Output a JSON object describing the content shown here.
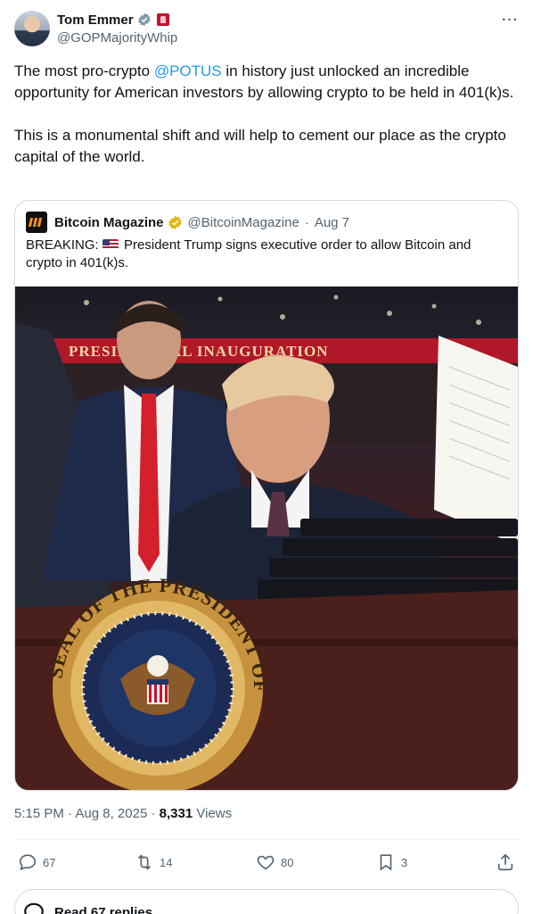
{
  "author": {
    "display_name": "Tom Emmer",
    "handle": "@GOPMajorityWhip"
  },
  "menu_icon": "more-horizontal-icon",
  "tweet": {
    "part1_before": "The most pro-crypto ",
    "mention": "@POTUS",
    "part1_after": " in history just unlocked an incredible opportunity for American investors by allowing crypto to be held in 401(k)s.",
    "part2": "This is a monumental shift and will help to cement our place as the crypto capital of the world."
  },
  "quote": {
    "display_name": "Bitcoin Magazine",
    "handle": "@BitcoinMagazine",
    "separator": "·",
    "date": "Aug 7",
    "text_prefix": "BREAKING: ",
    "text_body": "President Trump signs executive order to allow Bitcoin and crypto in 401(k)s.",
    "photo_banner_text": "PRESIDENTIAL INAUGURATION",
    "seal_text": "SEAL OF THE PRESIDENT OF THE UNITED STATES"
  },
  "meta": {
    "time": "5:15 PM",
    "separator": "·",
    "date": "Aug 8, 2025",
    "views_count": "8,331",
    "views_label": "Views"
  },
  "actions": {
    "replies": "67",
    "reposts": "14",
    "likes": "80",
    "bookmarks": "3"
  },
  "read_replies_label": "Read 67 replies",
  "colors": {
    "accent": "#1d9bf0",
    "text": "#0f1419",
    "muted": "#536471",
    "border": "#cfd9de",
    "verified_gold": "#e2b719"
  }
}
